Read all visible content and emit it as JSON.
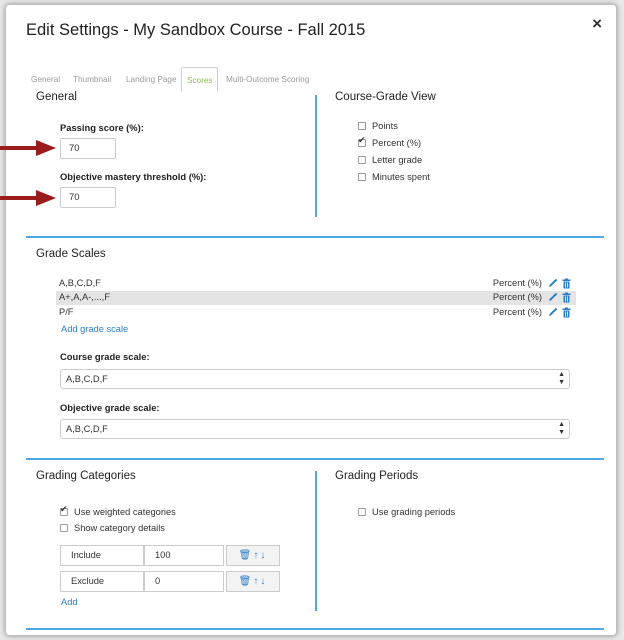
{
  "dialog": {
    "title": "Edit Settings - My Sandbox Course - Fall 2015",
    "close": "×"
  },
  "tabs": [
    {
      "label": "General",
      "active": false
    },
    {
      "label": "Thumbnail",
      "active": false
    },
    {
      "label": "Landing Page",
      "active": false
    },
    {
      "label": "Scores",
      "active": true
    },
    {
      "label": "Multi-Outcome Scoring",
      "active": false
    }
  ],
  "general": {
    "title": "General",
    "passing_score_label": "Passing score (%):",
    "passing_score_value": "70",
    "objective_mastery_label": "Objective mastery threshold (%):",
    "objective_mastery_value": "70"
  },
  "course_grade_view": {
    "title": "Course-Grade View",
    "options": [
      {
        "label": "Points",
        "checked": false
      },
      {
        "label": "Percent (%)",
        "checked": true
      },
      {
        "label": "Letter grade",
        "checked": false
      },
      {
        "label": "Minutes spent",
        "checked": false
      }
    ]
  },
  "grade_scales": {
    "title": "Grade Scales",
    "rows": [
      {
        "name": "A,B,C,D,F",
        "type": "Percent (%)"
      },
      {
        "name": "A+,A,A-,...,F",
        "type": "Percent (%)"
      },
      {
        "name": "P/F",
        "type": "Percent (%)"
      }
    ],
    "add_link": "Add grade scale",
    "course_scale_label": "Course grade scale:",
    "course_scale_value": "A,B,C,D,F",
    "objective_scale_label": "Objective grade scale:",
    "objective_scale_value": "A,B,C,D,F"
  },
  "grading_categories": {
    "title": "Grading Categories",
    "use_weighted_label": "Use weighted categories",
    "use_weighted_checked": true,
    "show_details_label": "Show category details",
    "show_details_checked": false,
    "categories": [
      {
        "name": "Include",
        "weight": "100"
      },
      {
        "name": "Exclude",
        "weight": "0"
      }
    ],
    "add_link": "Add"
  },
  "grading_periods": {
    "title": "Grading Periods",
    "use_periods_label": "Use grading periods",
    "use_periods_checked": false
  },
  "colors": {
    "accent": "#4fa8e0",
    "link": "#2c7ec7",
    "active_tab": "#8bc34a",
    "arrow": "#9b1c1c"
  },
  "icons": {
    "edit": "pencil-icon",
    "delete": "trash-icon",
    "up": "arrow-up-icon",
    "down": "arrow-down-icon",
    "annotation": "red-arrow-icon"
  }
}
